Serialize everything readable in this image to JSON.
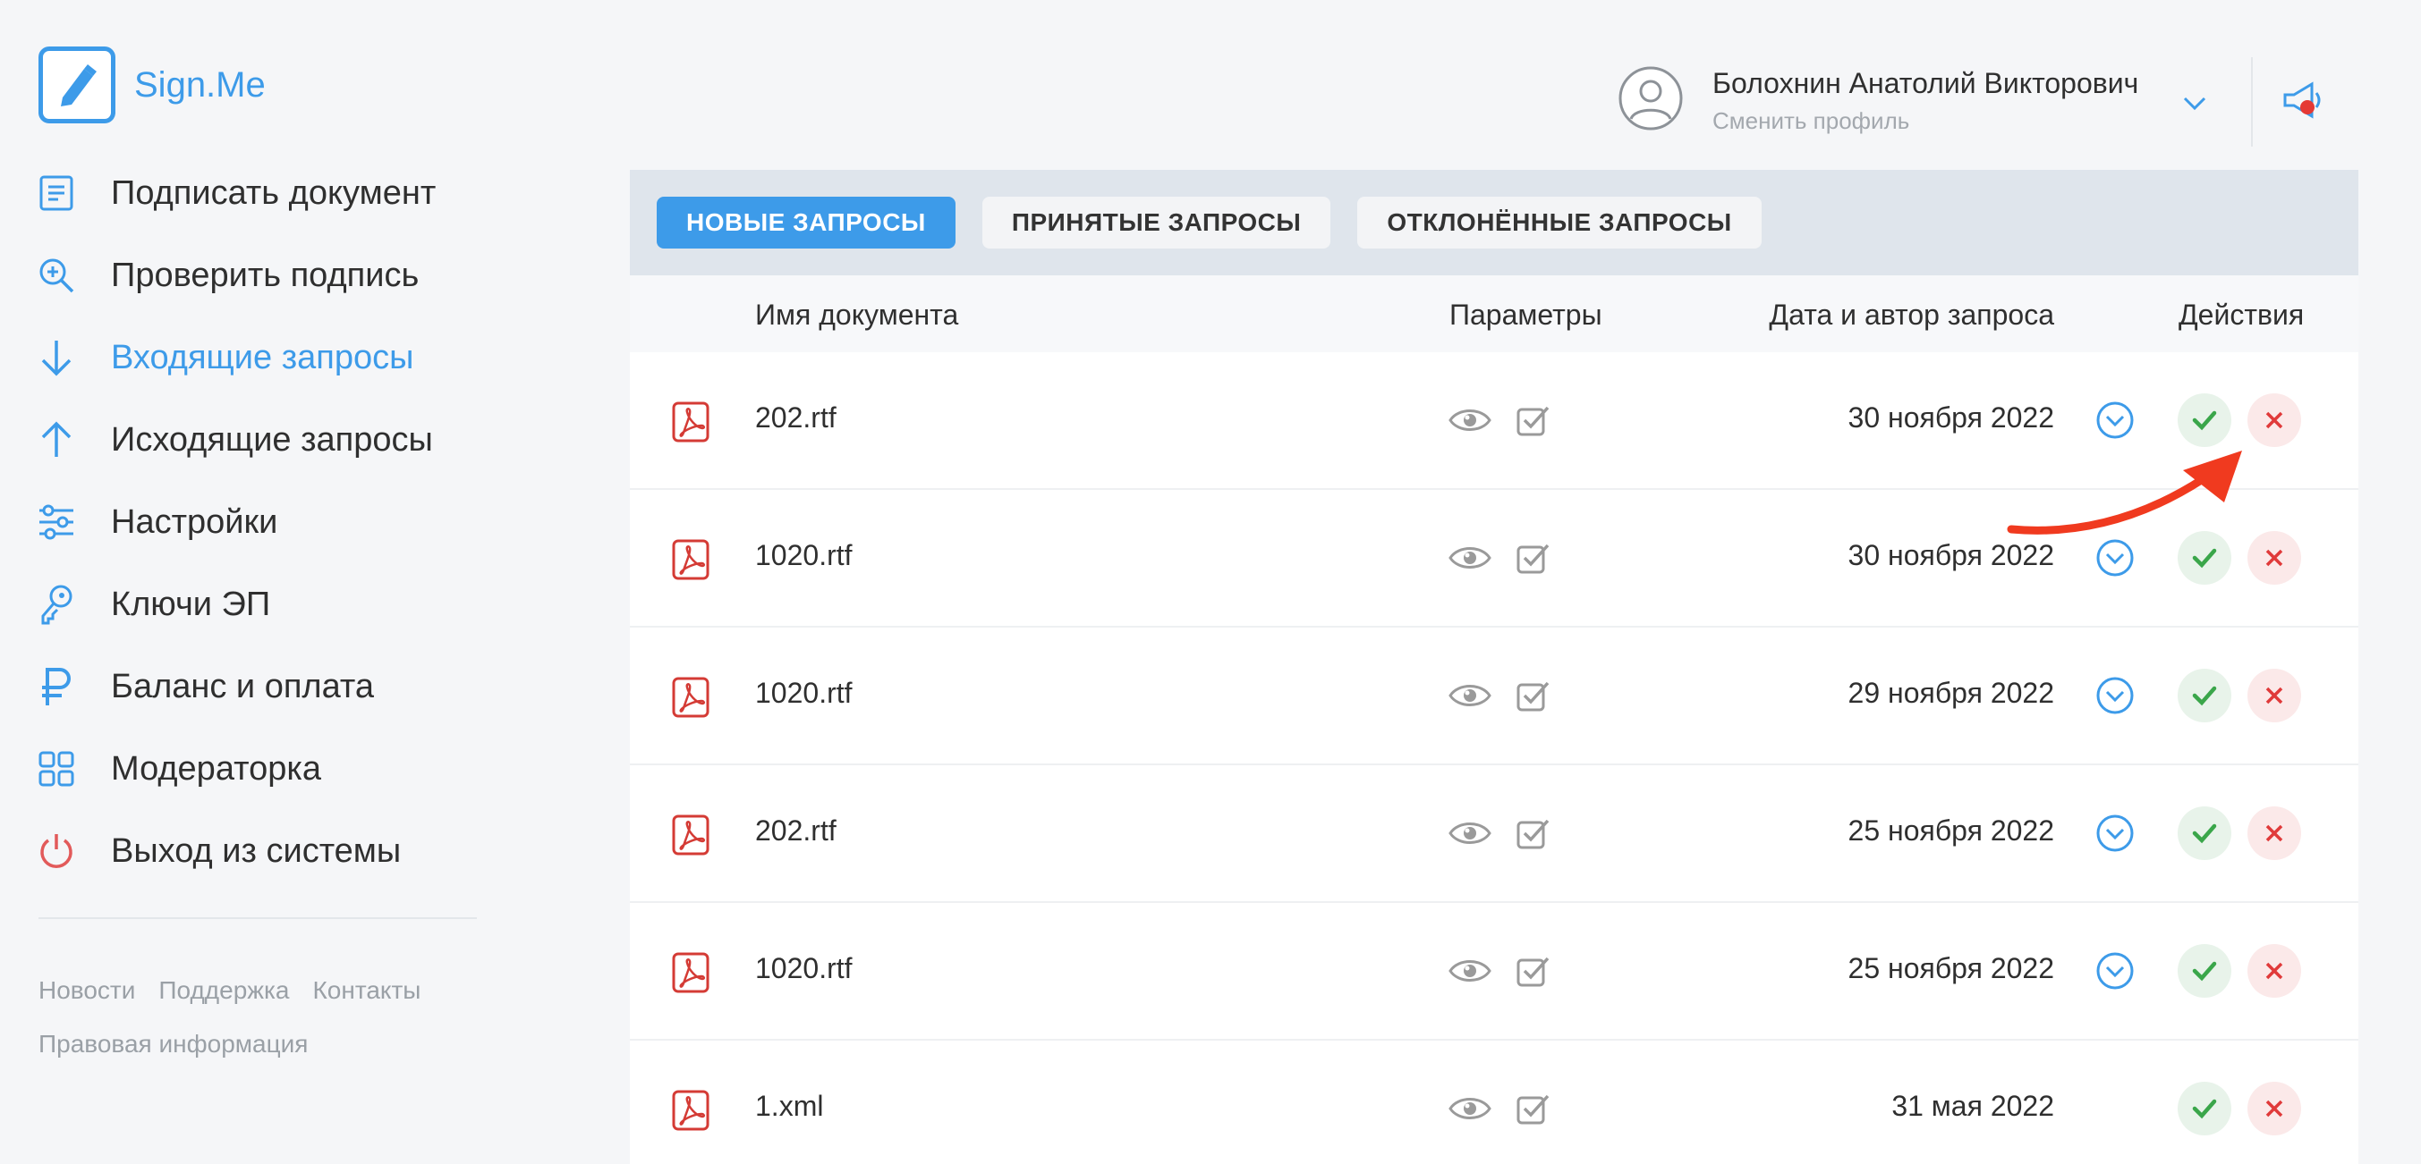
{
  "app": {
    "name": "Sign.Me",
    "accent": "#3d9be9"
  },
  "nav": [
    {
      "label": "Подписать документ",
      "icon": "document-icon",
      "active": false
    },
    {
      "label": "Проверить подпись",
      "icon": "search-plus-icon",
      "active": false
    },
    {
      "label": "Входящие запросы",
      "icon": "arrow-down-icon",
      "active": true
    },
    {
      "label": "Исходящие запросы",
      "icon": "arrow-up-icon",
      "active": false
    },
    {
      "label": "Настройки",
      "icon": "sliders-icon",
      "active": false
    },
    {
      "label": "Ключи ЭП",
      "icon": "key-icon",
      "active": false
    },
    {
      "label": "Баланс и оплата",
      "icon": "ruble-icon",
      "active": false
    },
    {
      "label": "Модераторка",
      "icon": "grid-icon",
      "active": false
    },
    {
      "label": "Выход из системы",
      "icon": "power-icon",
      "active": false
    }
  ],
  "footer": {
    "news": "Новости",
    "support": "Поддержка",
    "contacts": "Контакты",
    "legal": "Правовая информация"
  },
  "user": {
    "name": "Болохнин Анатолий Викторович",
    "switch_profile": "Сменить профиль"
  },
  "tabs": [
    {
      "label": "НОВЫЕ ЗАПРОСЫ",
      "active": true
    },
    {
      "label": "ПРИНЯТЫЕ ЗАПРОСЫ",
      "active": false
    },
    {
      "label": "ОТКЛОНЁННЫЕ ЗАПРОСЫ",
      "active": false
    }
  ],
  "table": {
    "headers": {
      "name": "Имя документа",
      "params": "Параметры",
      "date": "Дата и автор запроса",
      "actions": "Действия"
    },
    "rows": [
      {
        "name": "202.rtf",
        "date": "30 ноября 2022",
        "expand": true
      },
      {
        "name": "1020.rtf",
        "date": "30 ноября 2022",
        "expand": true
      },
      {
        "name": "1020.rtf",
        "date": "29 ноября 2022",
        "expand": true
      },
      {
        "name": "202.rtf",
        "date": "25 ноября 2022",
        "expand": true
      },
      {
        "name": "1020.rtf",
        "date": "25 ноября 2022",
        "expand": true
      },
      {
        "name": "1.xml",
        "date": "31 мая 2022",
        "expand": false
      }
    ]
  },
  "colors": {
    "accept": "#3aa64a",
    "reject": "#e03a3a",
    "pdf": "#d43b35",
    "annotation_arrow": "#f03a1f"
  }
}
